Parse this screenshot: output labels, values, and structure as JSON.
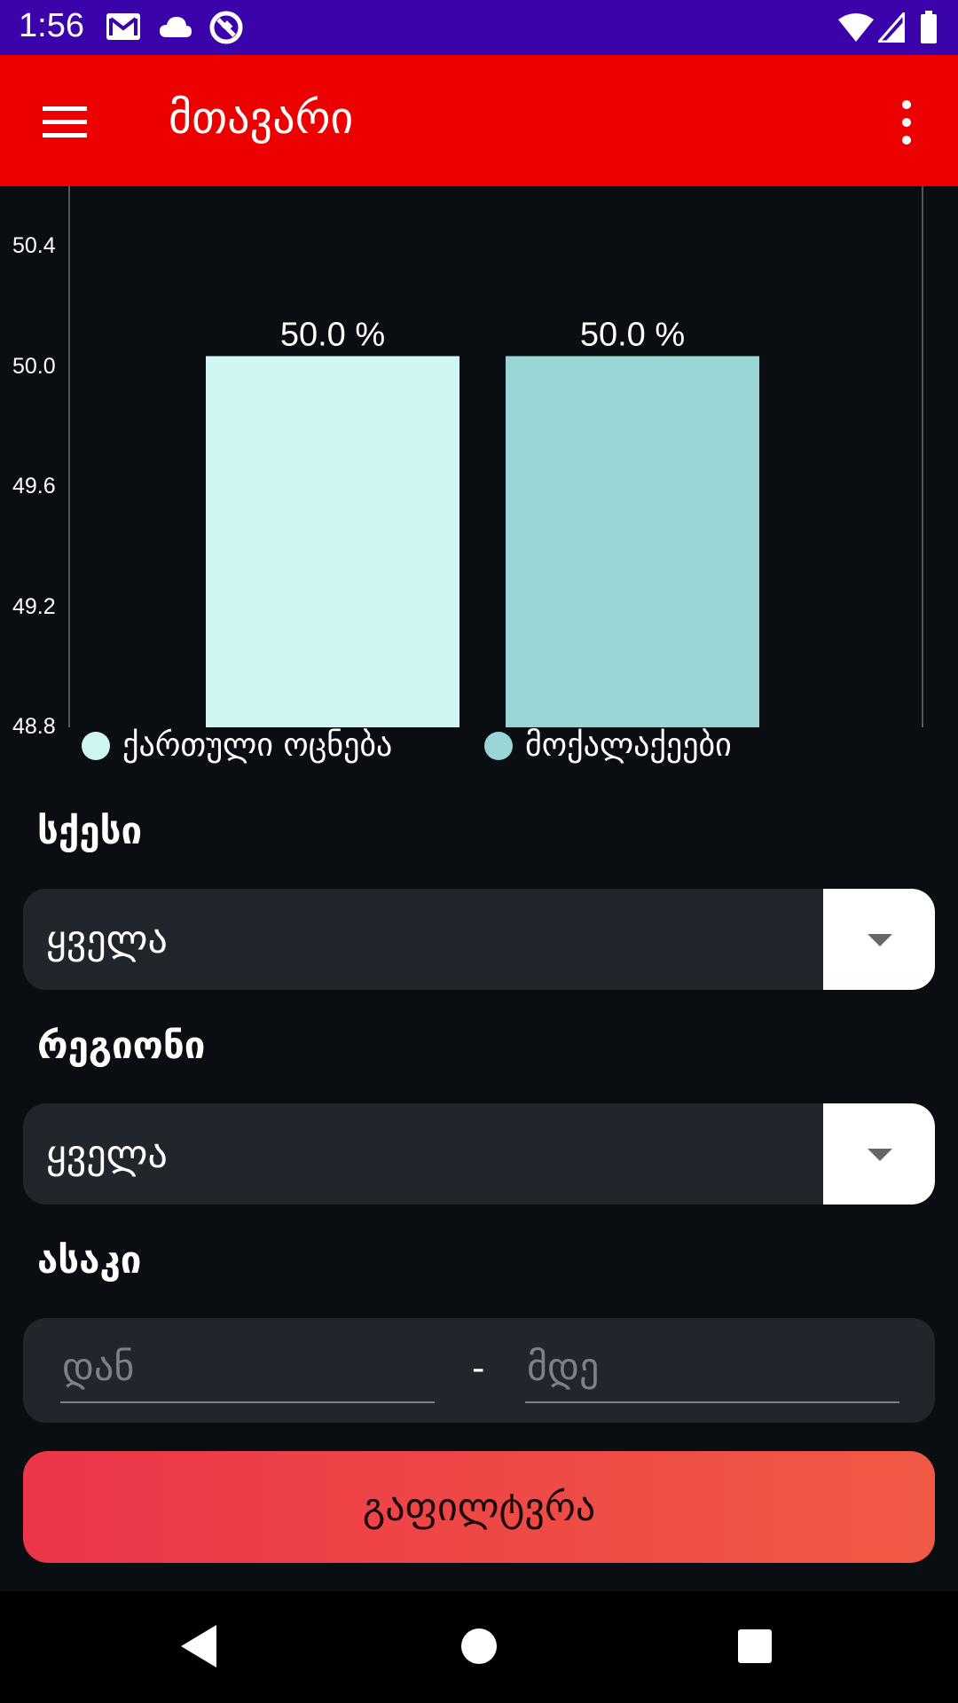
{
  "status_bar": {
    "time": "1:56",
    "icons": [
      "gmail-icon",
      "cloud-icon",
      "sync-icon",
      "wifi-icon",
      "signal-icon",
      "battery-icon"
    ]
  },
  "app_bar": {
    "title": "მთავარი",
    "background": "#ec0000"
  },
  "chart_data": {
    "type": "bar",
    "categories": [
      "ქართული ოცნება",
      "მოქალაქეები"
    ],
    "values": [
      50.0,
      50.0
    ],
    "value_labels": [
      "50.0 %",
      "50.0 %"
    ],
    "colors": [
      "#d0f6f4",
      "#99d5d5"
    ],
    "y_ticks": [
      "50.4",
      "50.0",
      "49.6",
      "49.2",
      "48.8"
    ],
    "ylim": [
      48.8,
      50.4
    ],
    "legend": [
      "ქართული ოცნება",
      "მოქალაქეები"
    ],
    "legend_position": "bottom-left",
    "grid": false
  },
  "form": {
    "gender_label": "სქესი",
    "gender_value": "ყველა",
    "region_label": "რეგიონი",
    "region_value": "ყველა",
    "age_label": "ასაკი",
    "age_from_placeholder": "დან",
    "age_separator": "-",
    "age_to_placeholder": "მდე",
    "filter_button": "გაფილტვრა"
  },
  "colors": {
    "status_bar": "#3b04ab",
    "background": "#0a0e13",
    "field": "#21262d",
    "button_gradient_start": "#ec3548",
    "button_gradient_end": "#f05a45"
  }
}
